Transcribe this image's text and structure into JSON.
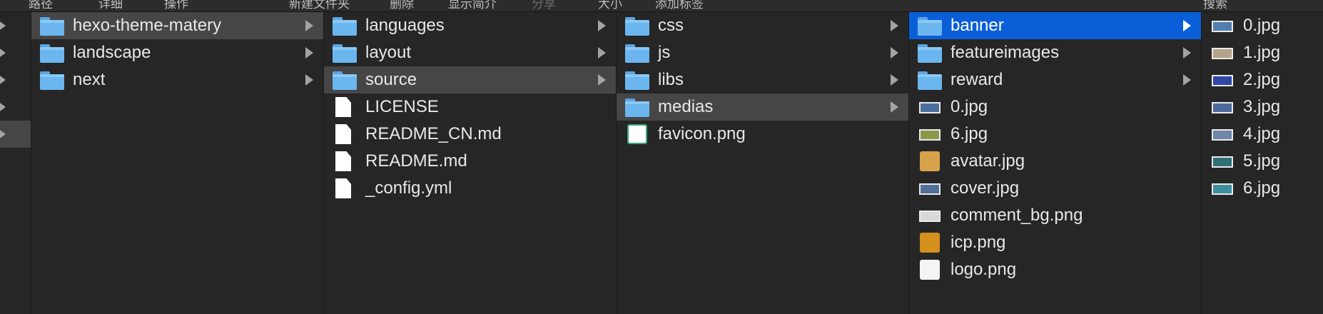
{
  "toolbar": {
    "labels": [
      "路径",
      "详细",
      "操作",
      "新建文件夹",
      "删除",
      "显示简介",
      "分享",
      "大小",
      "添加标签",
      "搜索"
    ]
  },
  "columns": [
    {
      "items": [
        {
          "name": "",
          "kind": "folder",
          "chevron": true,
          "selected": "none"
        },
        {
          "name": "",
          "kind": "folder",
          "chevron": true,
          "selected": "none"
        },
        {
          "name": "",
          "kind": "folder",
          "chevron": true,
          "selected": "none"
        },
        {
          "name": "",
          "kind": "folder",
          "chevron": true,
          "selected": "none"
        },
        {
          "name": "",
          "kind": "folder",
          "chevron": true,
          "selected": "gray"
        }
      ]
    },
    {
      "items": [
        {
          "name": "hexo-theme-matery",
          "kind": "folder",
          "chevron": true,
          "selected": "gray"
        },
        {
          "name": "landscape",
          "kind": "folder",
          "chevron": true,
          "selected": "none"
        },
        {
          "name": "next",
          "kind": "folder",
          "chevron": true,
          "selected": "none"
        }
      ]
    },
    {
      "items": [
        {
          "name": "languages",
          "kind": "folder",
          "chevron": true,
          "selected": "none"
        },
        {
          "name": "layout",
          "kind": "folder",
          "chevron": true,
          "selected": "none"
        },
        {
          "name": "source",
          "kind": "folder",
          "chevron": true,
          "selected": "gray"
        },
        {
          "name": "LICENSE",
          "kind": "doc",
          "chevron": false,
          "selected": "none"
        },
        {
          "name": "README_CN.md",
          "kind": "doc",
          "chevron": false,
          "selected": "none"
        },
        {
          "name": "README.md",
          "kind": "doc",
          "chevron": false,
          "selected": "none"
        },
        {
          "name": "_config.yml",
          "kind": "doc",
          "chevron": false,
          "selected": "none"
        }
      ]
    },
    {
      "items": [
        {
          "name": "css",
          "kind": "folder",
          "chevron": true,
          "selected": "none"
        },
        {
          "name": "js",
          "kind": "folder",
          "chevron": true,
          "selected": "none"
        },
        {
          "name": "libs",
          "kind": "folder",
          "chevron": true,
          "selected": "none"
        },
        {
          "name": "medias",
          "kind": "folder",
          "chevron": true,
          "selected": "gray"
        },
        {
          "name": "favicon.png",
          "kind": "favicon",
          "chevron": false,
          "selected": "none"
        }
      ]
    },
    {
      "items": [
        {
          "name": "banner",
          "kind": "folder",
          "chevron": true,
          "selected": "blue"
        },
        {
          "name": "featureimages",
          "kind": "folder",
          "chevron": true,
          "selected": "none"
        },
        {
          "name": "reward",
          "kind": "folder",
          "chevron": true,
          "selected": "none"
        },
        {
          "name": "0.jpg",
          "kind": "image",
          "thumb": "#4a6f9e",
          "chevron": false,
          "selected": "none"
        },
        {
          "name": "6.jpg",
          "kind": "image",
          "thumb": "#8a9a4a",
          "chevron": false,
          "selected": "none"
        },
        {
          "name": "avatar.jpg",
          "kind": "photo",
          "thumb": "#d8a24a",
          "chevron": false,
          "selected": "none"
        },
        {
          "name": "cover.jpg",
          "kind": "image",
          "thumb": "#50709a",
          "chevron": false,
          "selected": "none"
        },
        {
          "name": "comment_bg.png",
          "kind": "image",
          "thumb": "#d9d9d9",
          "chevron": false,
          "selected": "none"
        },
        {
          "name": "icp.png",
          "kind": "photo",
          "thumb": "#d4901c",
          "chevron": false,
          "selected": "none"
        },
        {
          "name": "logo.png",
          "kind": "photo",
          "thumb": "#f4f4f4",
          "chevron": false,
          "selected": "none"
        }
      ]
    },
    {
      "items": [
        {
          "name": "0.jpg",
          "kind": "image",
          "thumb": "#4f7fae",
          "chevron": false,
          "selected": "none"
        },
        {
          "name": "1.jpg",
          "kind": "image",
          "thumb": "#b5a28a",
          "chevron": false,
          "selected": "none"
        },
        {
          "name": "2.jpg",
          "kind": "image",
          "thumb": "#3046a8",
          "chevron": false,
          "selected": "none"
        },
        {
          "name": "3.jpg",
          "kind": "image",
          "thumb": "#4c6a9c",
          "chevron": false,
          "selected": "none"
        },
        {
          "name": "4.jpg",
          "kind": "image",
          "thumb": "#6e86a8",
          "chevron": false,
          "selected": "none"
        },
        {
          "name": "5.jpg",
          "kind": "image",
          "thumb": "#2f6f78",
          "chevron": false,
          "selected": "none"
        },
        {
          "name": "6.jpg",
          "kind": "image",
          "thumb": "#3d8ea0",
          "chevron": false,
          "selected": "none"
        }
      ]
    }
  ],
  "colors": {
    "background": "#232323",
    "column": "#262626",
    "selection_gray": "#464646",
    "selection_blue": "#0a5fd8",
    "folder": "#6bb6ef"
  }
}
